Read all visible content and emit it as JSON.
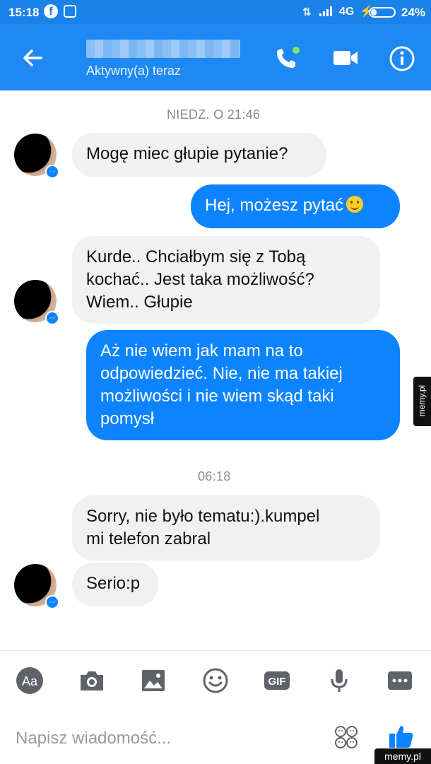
{
  "status_bar": {
    "time": "15:18",
    "network": "4G",
    "battery": "24%",
    "battery_level": 0.24,
    "icons": [
      "facebook-icon",
      "app-icon",
      "signal-icon",
      "charging-icon",
      "battery-icon"
    ]
  },
  "header": {
    "status": "Aktywny(a) teraz",
    "icons": [
      "back-arrow-icon",
      "phone-call-icon",
      "video-camera-icon",
      "info-icon"
    ]
  },
  "messages": {
    "timestamp1": "NIEDZ. O 21:46",
    "m1": "Mogę miec głupie pytanie?",
    "m2": "Hej, możesz pytać",
    "m3_lines": [
      "Kurde.. Chciałbym się z Tobą",
      "kochać.. Jest taka możliwość?",
      "Wiem.. Głupie"
    ],
    "m4_lines": [
      "Aż nie wiem jak mam na to",
      "odpowiedzieć. Nie, nie ma takiej",
      "możliwości i nie wiem skąd taki",
      "pomysł"
    ],
    "timestamp2": "06:18",
    "m5_lines": [
      "Sorry, nie było tematu:).kumpel",
      "mi telefon zabral"
    ],
    "m6": "Serio:p"
  },
  "composer": {
    "placeholder": "Napisz wiadomość...",
    "text_button": "Aa",
    "gif_button": "GIF",
    "icons": [
      "camera-icon",
      "image-icon",
      "emoji-icon",
      "microphone-icon",
      "more-icon",
      "sticker-icon",
      "thumbs-up-icon"
    ]
  },
  "watermark": {
    "side": "memy.pl",
    "bottom": "memy.pl"
  },
  "colors": {
    "header": "#1e88f5",
    "status_bar": "#1a82e8",
    "outgoing_bubble": "#0d84ff",
    "incoming_bubble": "#f1f1f1",
    "toolbar_icons": "#5f6268"
  }
}
